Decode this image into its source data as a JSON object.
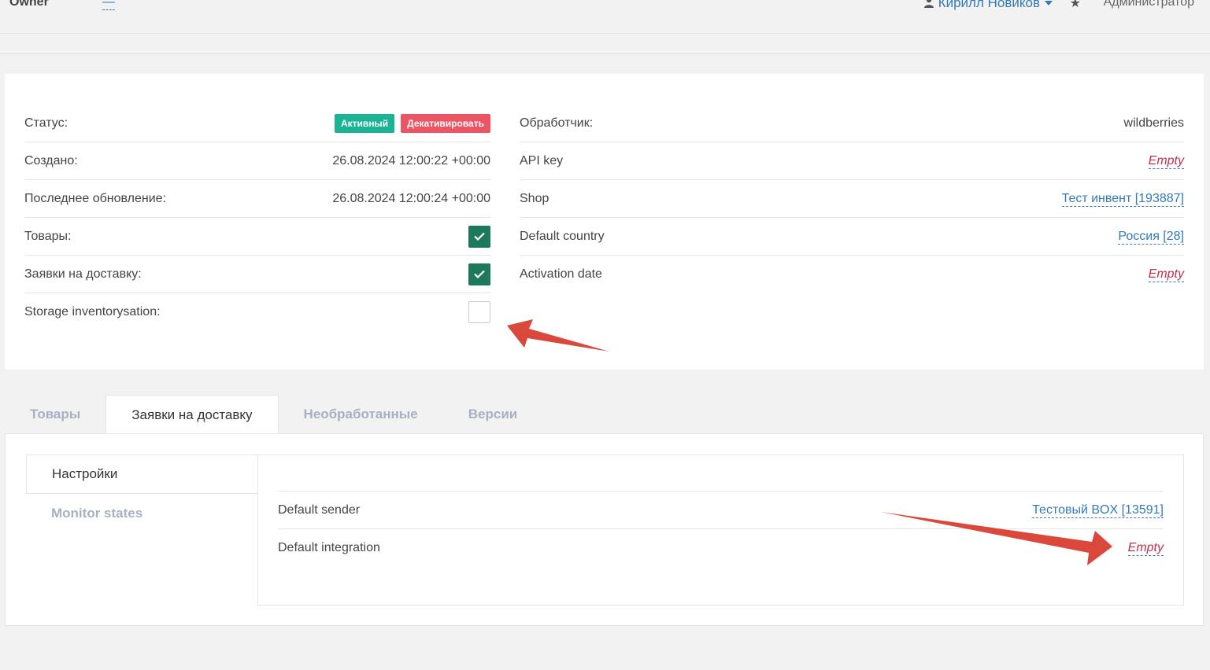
{
  "header": {
    "owner_label": "Owner",
    "owner_value": "—",
    "user_name": "Кирилл Новиков",
    "role": "Администратор"
  },
  "left_fields": [
    {
      "label": "Статус:"
    },
    {
      "label": "Создано:",
      "value": "26.08.2024 12:00:22 +00:00"
    },
    {
      "label": "Последнее обновление:",
      "value": "26.08.2024 12:00:24 +00:00"
    },
    {
      "label": "Товары:",
      "checked": true
    },
    {
      "label": "Заявки на доставку:",
      "checked": true
    },
    {
      "label": "Storage inventorysation:",
      "checked": false
    }
  ],
  "status": {
    "active_badge": "Активный",
    "deactivate_button": "Декативировать",
    "active_color": "#1ab394",
    "deactivate_color": "#ed5565"
  },
  "right_fields": [
    {
      "label": "Обработчик:",
      "value": "wildberries"
    },
    {
      "label": "API key",
      "value": "Empty"
    },
    {
      "label": "Shop",
      "value": "Тест инвент [193887]"
    },
    {
      "label": "Default country",
      "value": "Россия [28]"
    },
    {
      "label": "Activation date",
      "value": "Empty"
    }
  ],
  "tabs": [
    "Товары",
    "Заявки на доставку",
    "Необработанные",
    "Версии"
  ],
  "subnav": [
    "Настройки",
    "Monitor states"
  ],
  "settings": [
    {
      "label": "Default sender",
      "value": "Тестовый BOX [13591]"
    },
    {
      "label": "Default integration",
      "value": "Empty"
    }
  ],
  "colors": {
    "link": "#337ab7",
    "empty": "#c0304a",
    "checkbox_on": "#1c7a5a",
    "annotation_arrow": "#d9483b"
  }
}
